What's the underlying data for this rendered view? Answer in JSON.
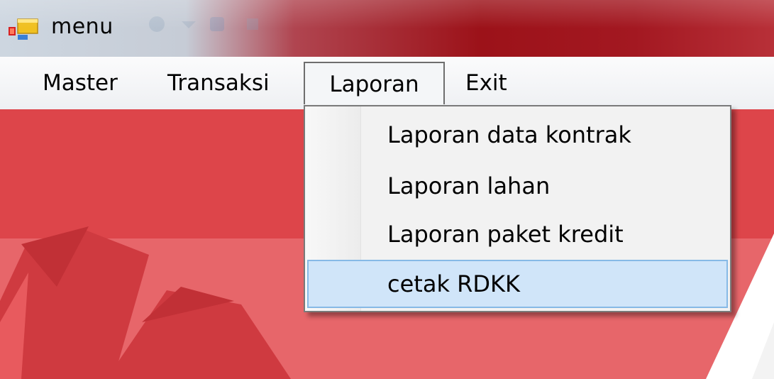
{
  "window": {
    "title": "menu",
    "app_icon": "windows-form-icon"
  },
  "menubar": {
    "items": [
      {
        "label": "Master"
      },
      {
        "label": "Transaksi"
      },
      {
        "label": "Laporan",
        "open": true
      },
      {
        "label": "Exit"
      }
    ]
  },
  "dropdown": {
    "items": [
      {
        "label": "Laporan data kontrak"
      },
      {
        "label": "Laporan lahan"
      },
      {
        "label": "Laporan paket kredit"
      },
      {
        "label": "cetak RDKK",
        "highlighted": true
      }
    ]
  },
  "colors": {
    "background_red": "#e45f63",
    "shape_dark_red": "#cf3a40",
    "highlight_fill": "#d0e5f9",
    "highlight_border": "#86b9e6"
  }
}
